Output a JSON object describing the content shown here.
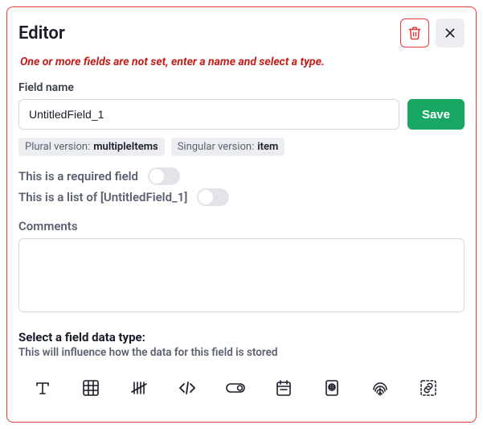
{
  "panel": {
    "title": "Editor",
    "error": "One or more fields are not set, enter a name and select a type."
  },
  "field": {
    "name_label": "Field name",
    "name_value": "UntitledField_1",
    "save_label": "Save"
  },
  "badges": {
    "plural_label": "Plural version:",
    "plural_value": "multipleItems",
    "singular_label": "Singular version:",
    "singular_value": "item"
  },
  "toggles": {
    "required_label": "This is a required field",
    "list_label": "This is a list of [UntitledField_1]"
  },
  "comments": {
    "label": "Comments",
    "value": ""
  },
  "datatype": {
    "heading": "Select a field data type:",
    "subheading": "This will influence how the data for this field is stored"
  }
}
